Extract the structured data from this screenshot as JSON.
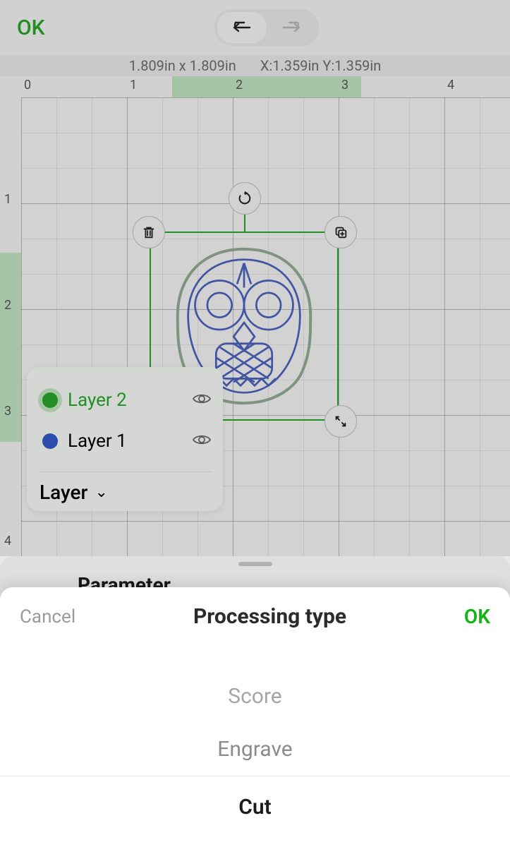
{
  "topbar": {
    "ok": "OK"
  },
  "status": {
    "dims": "1.809in x 1.809in",
    "coords": "X:1.359in Y:1.359in"
  },
  "ruler": {
    "h": [
      "0",
      "1",
      "2",
      "3",
      "4"
    ],
    "v": [
      "1",
      "2",
      "3",
      "4"
    ]
  },
  "layers": {
    "items": [
      {
        "name": "Layer 2",
        "color": "#18a718",
        "active": true
      },
      {
        "name": "Layer 1",
        "color": "#2b57d8",
        "active": false
      }
    ],
    "header": "Layer"
  },
  "parameter": {
    "label": "Parameter"
  },
  "sheet": {
    "cancel": "Cancel",
    "title": "Processing type",
    "ok": "OK",
    "options": [
      "Score",
      "Engrave",
      "Cut"
    ],
    "selected": "Cut"
  }
}
